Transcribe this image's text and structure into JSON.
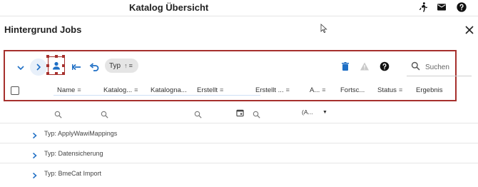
{
  "app": {
    "title": "Katalog Übersicht"
  },
  "dialog": {
    "title": "Hintergrund Jobs"
  },
  "toolbar": {
    "group_chip": {
      "label": "Typ",
      "sort_glyph": "↑",
      "filter_glyph": "≡"
    },
    "search_placeholder": "Suchen"
  },
  "columns": [
    {
      "label": "Name"
    },
    {
      "label": "Katalog..."
    },
    {
      "label": "Katalogna..."
    },
    {
      "label": "Erstellt"
    },
    {
      "label": "Erstellt ..."
    },
    {
      "label": "A..."
    },
    {
      "label": "Fortsc..."
    },
    {
      "label": "Status"
    },
    {
      "label": "Ergebnis"
    }
  ],
  "filters": {
    "status_select": "(A..."
  },
  "groups": [
    {
      "label": "Typ: ApplyWawiMappings"
    },
    {
      "label": "Typ: Datensicherung"
    },
    {
      "label": "Typ: BmeCat Import"
    }
  ],
  "colors": {
    "accent": "#1f6fc5",
    "highlight": "#a6302d",
    "chip": "#e5e5e5"
  }
}
